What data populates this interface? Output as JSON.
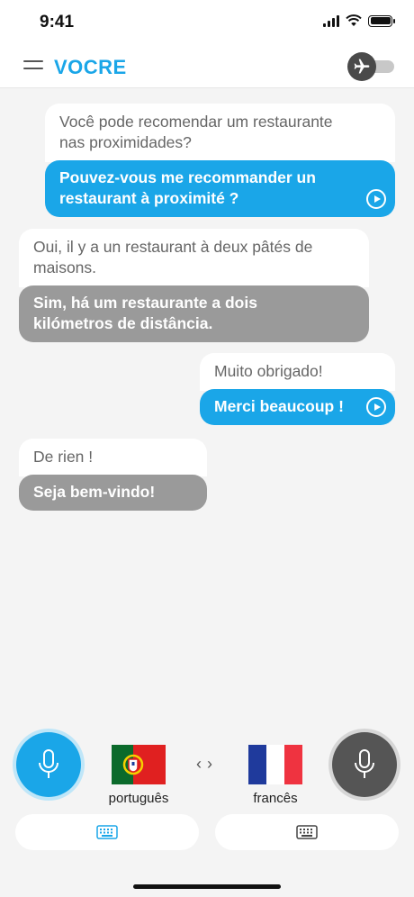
{
  "status_bar": {
    "time": "9:41"
  },
  "header": {
    "logo": "VOCRE",
    "offline_mode_on": false
  },
  "conversation": [
    {
      "side": "right",
      "original": "Você pode recomendar um restaurante nas proximidades?",
      "translation": "Pouvez-vous me recommander un restaurant à proximité ?"
    },
    {
      "side": "left",
      "original": "Oui, il y a un restaurant à deux pâtés de maisons.",
      "translation": "Sim, há um restaurante a dois kilómetros de distância."
    },
    {
      "side": "right",
      "original": "Muito obrigado!",
      "translation": "Merci beaucoup !"
    },
    {
      "side": "left",
      "original": "De rien !",
      "translation": "Seja bem-vindo!"
    }
  ],
  "languages": {
    "left": {
      "name": "português",
      "flag_icon": "portugal-flag-icon"
    },
    "right": {
      "name": "francês",
      "flag_icon": "france-flag-icon"
    }
  },
  "colors": {
    "accent": "#1aa6e8",
    "left_bubble": "#9a9a9a",
    "right_mic": "#555555",
    "background": "#f4f4f4"
  }
}
